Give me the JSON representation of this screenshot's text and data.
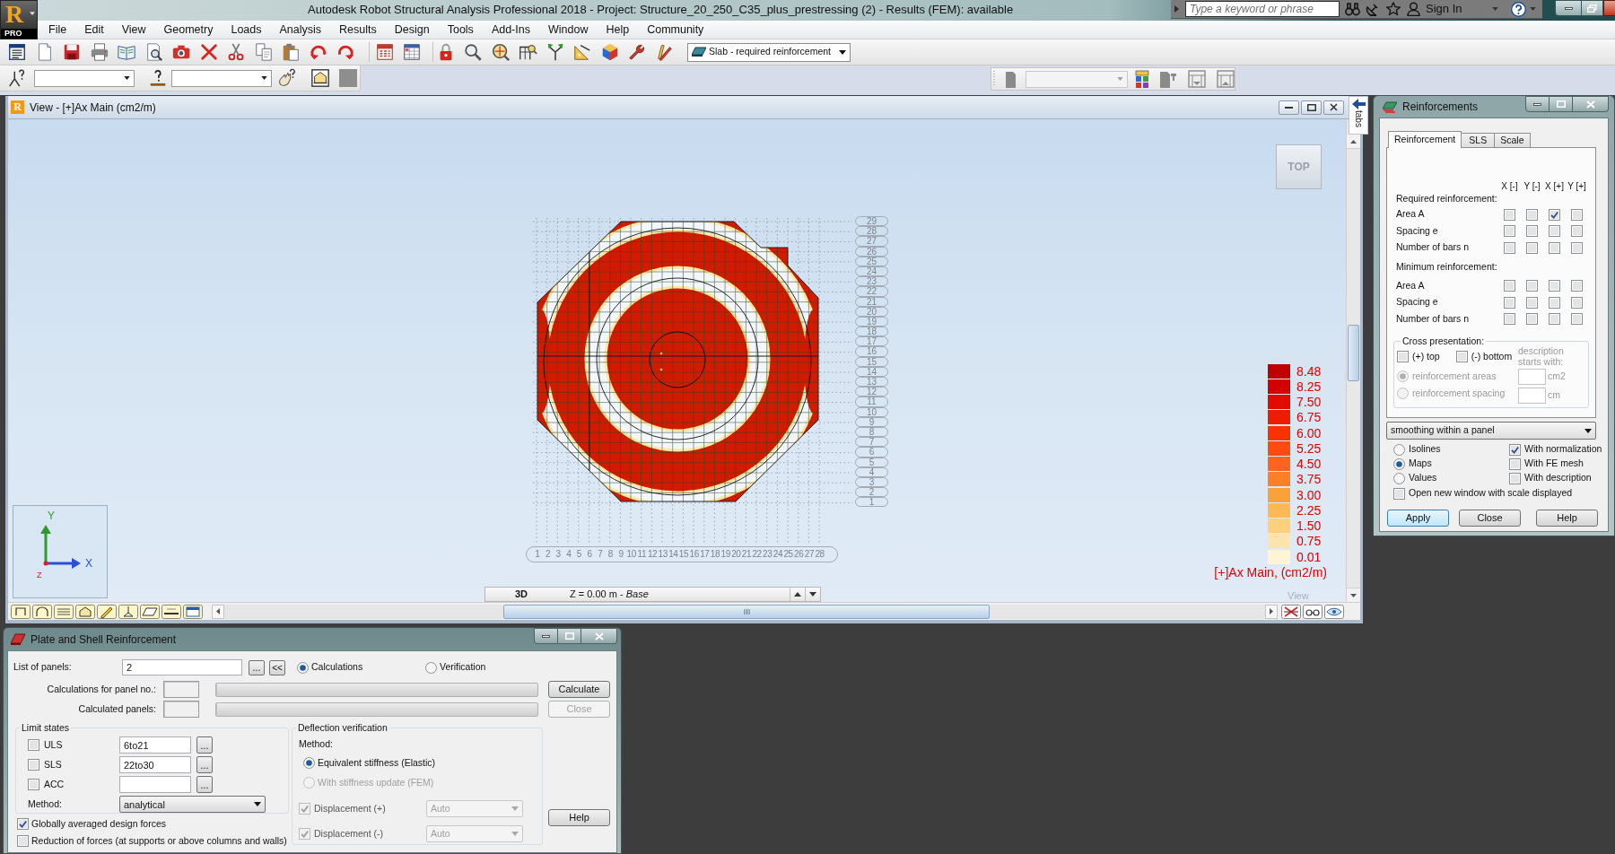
{
  "app": {
    "logo_letter": "R",
    "logo_badge": "PRO",
    "title": "Autodesk Robot Structural Analysis Professional 2018 - Project: Structure_20_250_C35_plus_prestressing (2) - Results (FEM): available"
  },
  "help_bar": {
    "search": {
      "placeholder": "Type a keyword or phrase"
    },
    "sign_in": "Sign In"
  },
  "menu": [
    "File",
    "Edit",
    "View",
    "Geometry",
    "Loads",
    "Analysis",
    "Results",
    "Design",
    "Tools",
    "Add-Ins",
    "Window",
    "Help",
    "Community"
  ],
  "toolbar": {
    "result_type": "Slab - required reinforcement"
  },
  "view_window": {
    "icon_letter": "R",
    "title": "View - [+]Ax Main (cm2/m)",
    "side_tab": "tabs",
    "view_cube": "TOP",
    "axes": {
      "y": "Y",
      "x": "X",
      "z": "Z"
    },
    "grid_rows": [
      "29",
      "28",
      "27",
      "26",
      "25",
      "24",
      "23",
      "22",
      "21",
      "20",
      "19",
      "18",
      "17",
      "16",
      "15",
      "14",
      "13",
      "12",
      "11",
      "10",
      "9",
      "8",
      "7",
      "6",
      "5",
      "4",
      "3",
      "2",
      "1"
    ],
    "grid_columns": [
      "1",
      "2",
      "3",
      "4",
      "5",
      "6",
      "7",
      "8",
      "9",
      "10",
      "11",
      "12",
      "13",
      "14",
      "15",
      "16",
      "17",
      "18",
      "19",
      "20",
      "21",
      "22",
      "23",
      "24",
      "25",
      "26",
      "27",
      "28"
    ],
    "legend": [
      {
        "value": "8.48",
        "color": "#c00000"
      },
      {
        "value": "8.25",
        "color": "#d20000"
      },
      {
        "value": "7.50",
        "color": "#e30a00"
      },
      {
        "value": "6.75",
        "color": "#f01c00"
      },
      {
        "value": "6.00",
        "color": "#fa3200"
      },
      {
        "value": "5.25",
        "color": "#ff4a10"
      },
      {
        "value": "4.50",
        "color": "#ff641e"
      },
      {
        "value": "3.75",
        "color": "#fd8028"
      },
      {
        "value": "3.00",
        "color": "#f9a23a"
      },
      {
        "value": "2.25",
        "color": "#fbba55"
      },
      {
        "value": "1.50",
        "color": "#fcd07c"
      },
      {
        "value": "0.75",
        "color": "#fde4aa"
      },
      {
        "value": "0.01",
        "color": "#fff5d6"
      }
    ],
    "legend_caption": "[+]Ax Main, (cm2/m)",
    "projection": "3D",
    "elevation": "Z = 0.00 m - *Base*",
    "view_label": "View"
  },
  "reinforcements": {
    "title": "Reinforcements",
    "tabs": [
      {
        "label": "Reinforcement",
        "selected": true
      },
      {
        "label": "SLS",
        "selected": false
      },
      {
        "label": "Scale",
        "selected": false
      }
    ],
    "columns": [
      "X [-]",
      "Y [-]",
      "X [+]",
      "Y [+]"
    ],
    "sections": [
      {
        "heading": "Required reinforcement:",
        "rows": [
          {
            "label": "Area A",
            "checks": [
              {
                "checked": false
              },
              {
                "checked": false
              },
              {
                "checked": true
              },
              {
                "checked": false
              }
            ]
          },
          {
            "label": "Spacing e",
            "checks": [
              {
                "checked": false
              },
              {
                "checked": false
              },
              {
                "checked": false
              },
              {
                "checked": false
              }
            ]
          },
          {
            "label": "Number of bars n",
            "checks": [
              {
                "checked": false
              },
              {
                "checked": false
              },
              {
                "checked": false
              },
              {
                "checked": false
              }
            ]
          }
        ]
      },
      {
        "heading": "Minimum reinforcement:",
        "rows": [
          {
            "label": "Area A",
            "checks": [
              {
                "checked": false
              },
              {
                "checked": false
              },
              {
                "checked": false
              },
              {
                "checked": false
              }
            ]
          },
          {
            "label": "Spacing e",
            "checks": [
              {
                "checked": false
              },
              {
                "checked": false
              },
              {
                "checked": false
              },
              {
                "checked": false
              }
            ]
          },
          {
            "label": "Number of bars n",
            "checks": [
              {
                "checked": false
              },
              {
                "checked": false
              },
              {
                "checked": false
              },
              {
                "checked": false
              }
            ]
          }
        ]
      }
    ],
    "cross_presentation": {
      "title": "Cross presentation:",
      "sides": [
        {
          "label": "(+) top",
          "checked": false
        },
        {
          "label": "(-) bottom",
          "checked": false
        }
      ],
      "hint": "description starts with:",
      "options": [
        {
          "label": "reinforcement areas",
          "selected": true,
          "disabled": true,
          "unit": "cm2"
        },
        {
          "label": "reinforcement spacing",
          "selected": false,
          "disabled": true,
          "unit": "cm"
        }
      ]
    },
    "smoothing": "smoothing within a panel",
    "display_modes": [
      {
        "label": "Isolines",
        "selected": false
      },
      {
        "label": "Maps",
        "selected": true
      },
      {
        "label": "Values",
        "selected": false
      }
    ],
    "display_options": [
      {
        "label": "With normalization",
        "checked": true
      },
      {
        "label": "With FE mesh",
        "checked": false
      },
      {
        "label": "With description",
        "checked": false
      }
    ],
    "open_scale_window": {
      "label": "Open new window with scale displayed",
      "checked": false
    },
    "buttons": [
      {
        "label": "Apply",
        "default": true
      },
      {
        "label": "Close",
        "default": false
      },
      {
        "label": "Help",
        "default": false
      }
    ]
  },
  "plate_shell": {
    "title": "Plate and Shell Reinforcement",
    "panels": {
      "label": "List of panels:",
      "value": "2",
      "browse": "...",
      "back": "<<"
    },
    "modes": [
      {
        "label": "Calculations",
        "selected": true
      },
      {
        "label": "Verification",
        "selected": false
      }
    ],
    "progress": [
      {
        "label": "Calculations for panel no.:",
        "level": 0
      },
      {
        "label": "Calculated panels:",
        "level": 0
      }
    ],
    "actions": [
      {
        "label": "Calculate",
        "disabled": false
      },
      {
        "label": "Close",
        "disabled": true
      }
    ],
    "limit_states": {
      "title": "Limit states",
      "rows": [
        {
          "label": "ULS",
          "checked": false,
          "value": "6to21",
          "browse": "..."
        },
        {
          "label": "SLS",
          "checked": false,
          "value": "22to30",
          "browse": "..."
        },
        {
          "label": "ACC",
          "checked": false,
          "browse": "..."
        }
      ],
      "method_label": "Method:",
      "method": "analytical"
    },
    "deflection": {
      "title": "Deflection verification",
      "method_label": "Method:",
      "methods": [
        {
          "label": "Equivalent stiffness (Elastic)",
          "selected": true,
          "disabled": false
        },
        {
          "label": "With stiffness update (FEM)",
          "selected": false,
          "disabled": true
        }
      ],
      "displacements": [
        {
          "label": "Displacement (+)",
          "checked": true,
          "disabled": true,
          "value": "Auto"
        },
        {
          "label": "Displacement (-)",
          "checked": true,
          "disabled": true,
          "value": "Auto"
        }
      ]
    },
    "help": "Help",
    "options": [
      {
        "label": "Globally averaged design forces",
        "checked": true
      },
      {
        "label": "Reduction of forces (at supports or above columns and walls)",
        "checked": false
      }
    ]
  }
}
